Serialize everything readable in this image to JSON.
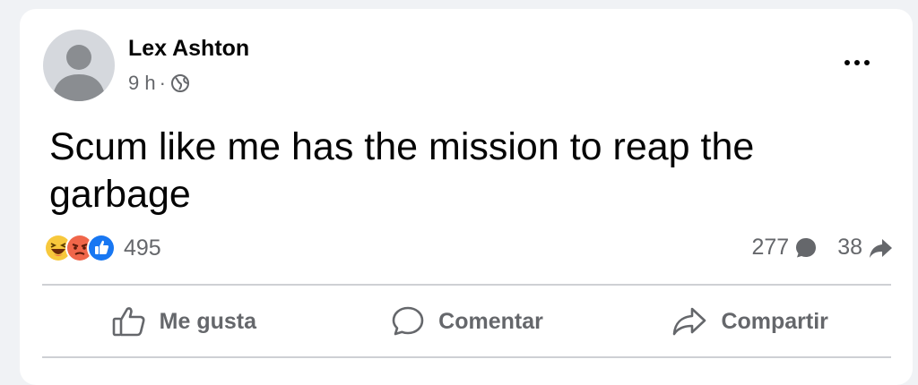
{
  "post": {
    "author": "Lex Ashton",
    "time": "9 h",
    "separator": "·",
    "audience_icon": "globe-icon",
    "text": "Scum like me has the mission to reap the garbage"
  },
  "reactions": {
    "icons": [
      "haha-icon",
      "angry-icon",
      "like-icon"
    ],
    "count": "495"
  },
  "stats": {
    "comments": "277",
    "shares": "38"
  },
  "actions": {
    "like": "Me gusta",
    "comment": "Comentar",
    "share": "Compartir"
  },
  "colors": {
    "like_blue": "#1877f2",
    "angry_orange": "#f0664a",
    "haha_yellow": "#f7c83c",
    "secondary_text": "#65676b"
  }
}
